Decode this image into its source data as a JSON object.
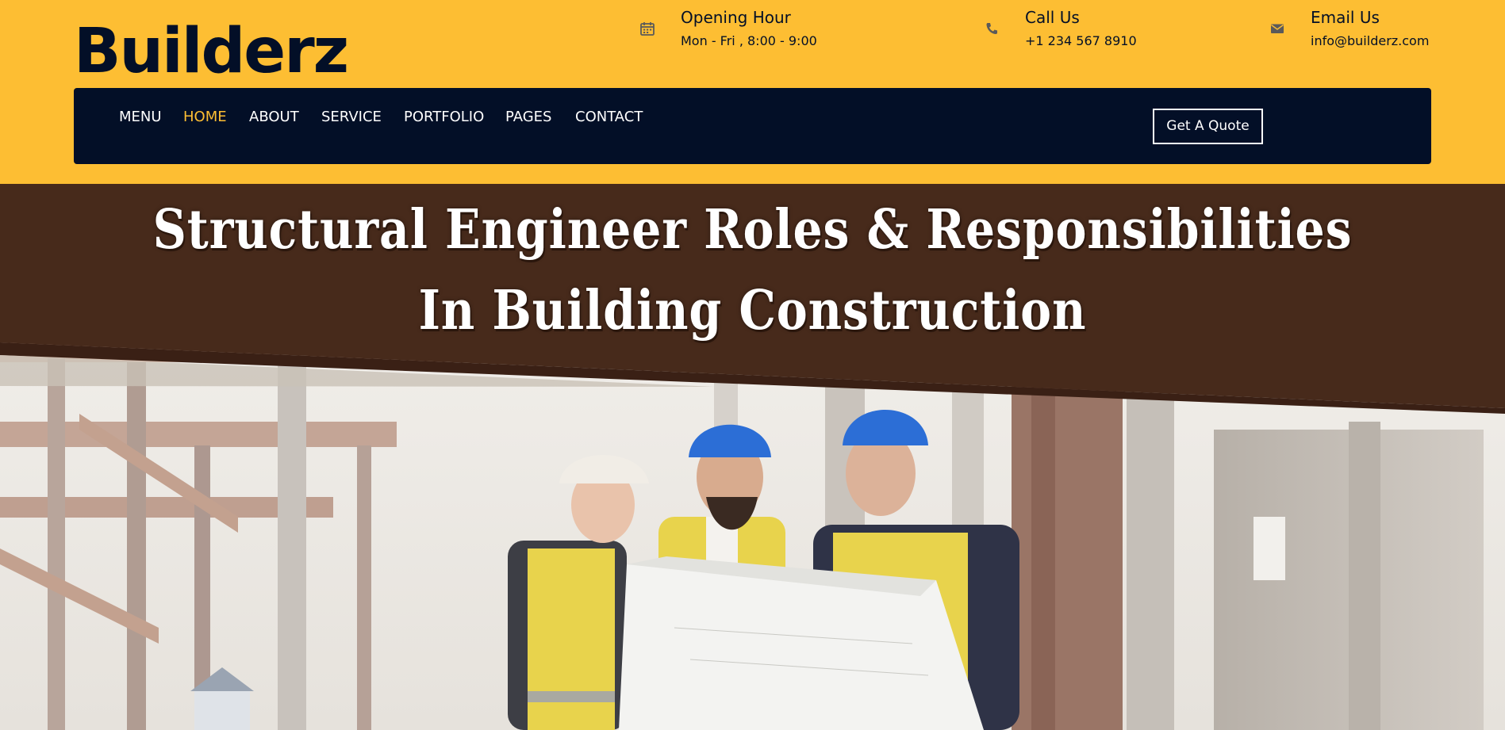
{
  "brand": {
    "logo_text": "Builderz"
  },
  "contact_info": {
    "hours": {
      "icon": "calendar-icon",
      "title": "Opening Hour",
      "value": "Mon - Fri , 8:00 - 9:00"
    },
    "call": {
      "icon": "phone-icon",
      "title": "Call Us",
      "value": "+1 234 567 8910"
    },
    "email": {
      "icon": "envelope-icon",
      "title": "Email Us",
      "value": "info@builderz.com"
    }
  },
  "nav": {
    "items": [
      {
        "label": "MENU",
        "active": false
      },
      {
        "label": "HOME",
        "active": true
      },
      {
        "label": "ABOUT",
        "active": false
      },
      {
        "label": "SERVICE",
        "active": false
      },
      {
        "label": "PORTFOLIO",
        "active": false
      },
      {
        "label": "PAGES",
        "active": false
      },
      {
        "label": "CONTACT",
        "active": false
      }
    ],
    "quote_button": "Get A Quote"
  },
  "hero": {
    "headline_line1": "Structural Engineer Roles & Responsibilities",
    "headline_line2": "In Building Construction"
  },
  "colors": {
    "brand_yellow": "#fdbe33",
    "navy": "#030f27",
    "banner_brown": "#472a1b",
    "white": "#ffffff"
  }
}
